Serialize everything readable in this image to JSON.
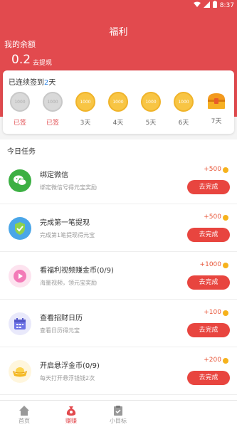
{
  "status_bar": {
    "time": "8:37"
  },
  "header": {
    "title": "福利",
    "balance_label": "我的余额",
    "balance_value": "0.2",
    "withdraw_label": "去提现"
  },
  "checkin": {
    "title_prefix": "已连续签到",
    "title_count": "2",
    "title_suffix": "天",
    "days": [
      {
        "coin": "1000",
        "label": "已签",
        "signed": true
      },
      {
        "coin": "1000",
        "label": "已签",
        "signed": true
      },
      {
        "coin": "1000",
        "label": "3天",
        "signed": false
      },
      {
        "coin": "1000",
        "label": "4天",
        "signed": false
      },
      {
        "coin": "1000",
        "label": "5天",
        "signed": false
      },
      {
        "coin": "1000",
        "label": "6天",
        "signed": false
      },
      {
        "coin": "",
        "label": "7天",
        "signed": false
      }
    ]
  },
  "tasks": {
    "title": "今日任务",
    "items": [
      {
        "name": "绑定微信",
        "desc": "绑定微信号得元宝奖励",
        "reward": "+500",
        "button": "去完成",
        "icon": "wechat-icon",
        "color": "#3cb043"
      },
      {
        "name": "完成第一笔提现",
        "desc": "完成第1笔提现得元宝",
        "reward": "+500",
        "button": "去完成",
        "icon": "shield-icon",
        "color": "#4aa6e8"
      },
      {
        "name": "看福利视频赚金币(0/9)",
        "desc": "海量视频，领元宝奖励",
        "reward": "+1000",
        "button": "去完成",
        "icon": "play-icon",
        "color": "#f37ab8"
      },
      {
        "name": "查看招财日历",
        "desc": "查看日历得元宝",
        "reward": "+100",
        "button": "去完成",
        "icon": "calendar-icon",
        "color": "#6e73e6"
      },
      {
        "name": "开启悬浮金币(0/9)",
        "desc": "每天打开悬浮钱钱2次",
        "reward": "+200",
        "button": "去完成",
        "icon": "gold-ingot-icon",
        "color": "#f5b820"
      }
    ]
  },
  "tabbar": {
    "items": [
      {
        "label": "首页",
        "active": false
      },
      {
        "label": "赚赚",
        "active": true
      },
      {
        "label": "小目标",
        "active": false
      }
    ]
  }
}
